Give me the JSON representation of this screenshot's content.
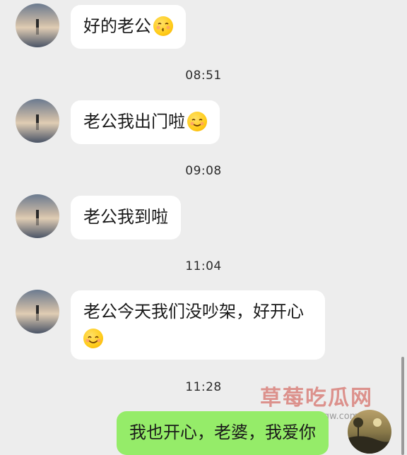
{
  "messages": [
    {
      "text": "好的老公",
      "emoji": "kissing-face-closed-eyes"
    },
    {
      "text": "老公我出门啦",
      "emoji": "smiling-face"
    },
    {
      "text": "老公我到啦"
    },
    {
      "text_line1": "老公今天我们没吵架，好开心",
      "emoji": "smiling-face-smiling-eyes"
    },
    {
      "text": "我也开心，老婆，我爱你"
    }
  ],
  "timestamps": [
    "08:51",
    "09:08",
    "11:04",
    "11:28"
  ],
  "watermark": {
    "text": "草莓吃瓜网",
    "url": "www.cmcgw.com"
  },
  "colors": {
    "background": "#ededed",
    "incoming_bubble": "#ffffff",
    "outgoing_bubble": "#95ec69"
  }
}
